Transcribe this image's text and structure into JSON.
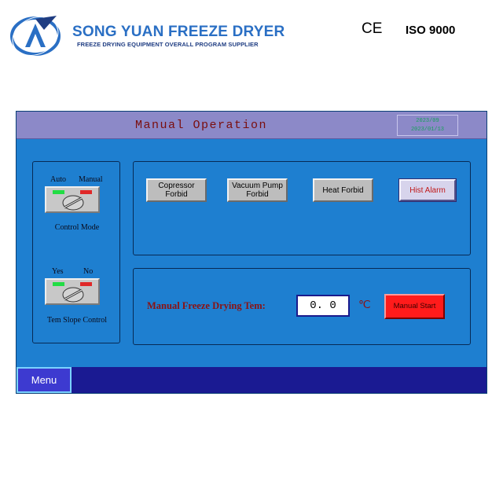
{
  "brand": {
    "name": "SONG YUAN FREEZE DRYER",
    "tagline": "FREEZE DRYING EQUIPMENT OVERALL PROGRAM SUPPLIER",
    "certifications": [
      "CE",
      "ISO 9000"
    ]
  },
  "screen": {
    "title": "Manual Operation",
    "datetime": [
      "2023/09",
      "2023/01/13"
    ]
  },
  "control_mode": {
    "labels": [
      "Auto",
      "Manual"
    ],
    "caption": "Control Mode"
  },
  "slope_control": {
    "labels": [
      "Yes",
      "No"
    ],
    "caption": "Tem Slope Control"
  },
  "buttons": {
    "compressor": [
      "Copressor",
      "Forbid"
    ],
    "vacuum_pump": [
      "Vacuum Pump",
      "Forbid"
    ],
    "heat": "Heat Forbid",
    "alarm": "Hist Alarm"
  },
  "manual_freeze": {
    "label": "Manual Freeze Drying Tem:",
    "value": "0. 0",
    "unit": "℃",
    "start_label": "Manual Start"
  },
  "menu": {
    "label": "Menu"
  },
  "colors": {
    "screen_bg": "#1e7fd0",
    "title_bar": "#8c89c8",
    "brand_blue": "#2a6fc4",
    "start_red": "#ff1b1b",
    "bottom_bar": "#1a1a92"
  }
}
